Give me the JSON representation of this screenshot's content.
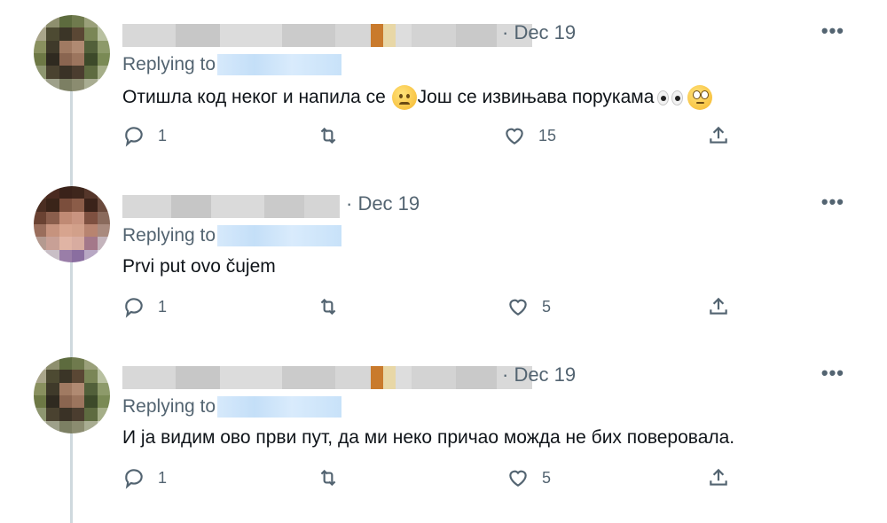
{
  "tweets": [
    {
      "date": "· Dec 19",
      "replying_label": "Replying to",
      "text_before": "Отишла код неког и напила се",
      "text_after": "Још се извињава порукама",
      "emoji": [
        "frowning-face",
        "eyes",
        "face-with-rolling-eyes"
      ],
      "replies": "1",
      "likes": "15"
    },
    {
      "date": "· Dec 19",
      "replying_label": "Replying to",
      "text": "Prvi put ovo čujem",
      "replies": "1",
      "likes": "5"
    },
    {
      "date": "· Dec 19",
      "replying_label": "Replying to",
      "text": "И ја видим ово први пут, да ми неко причао можда не бих поверовала.",
      "replies": "1",
      "likes": "5"
    }
  ],
  "icons": {
    "reply": "reply-icon",
    "retweet": "retweet-icon",
    "like": "heart-icon",
    "share": "share-icon",
    "more": "more-icon"
  },
  "colors": {
    "text": "#0f1419",
    "secondary": "#536471",
    "thread_line": "#cfd9de"
  }
}
